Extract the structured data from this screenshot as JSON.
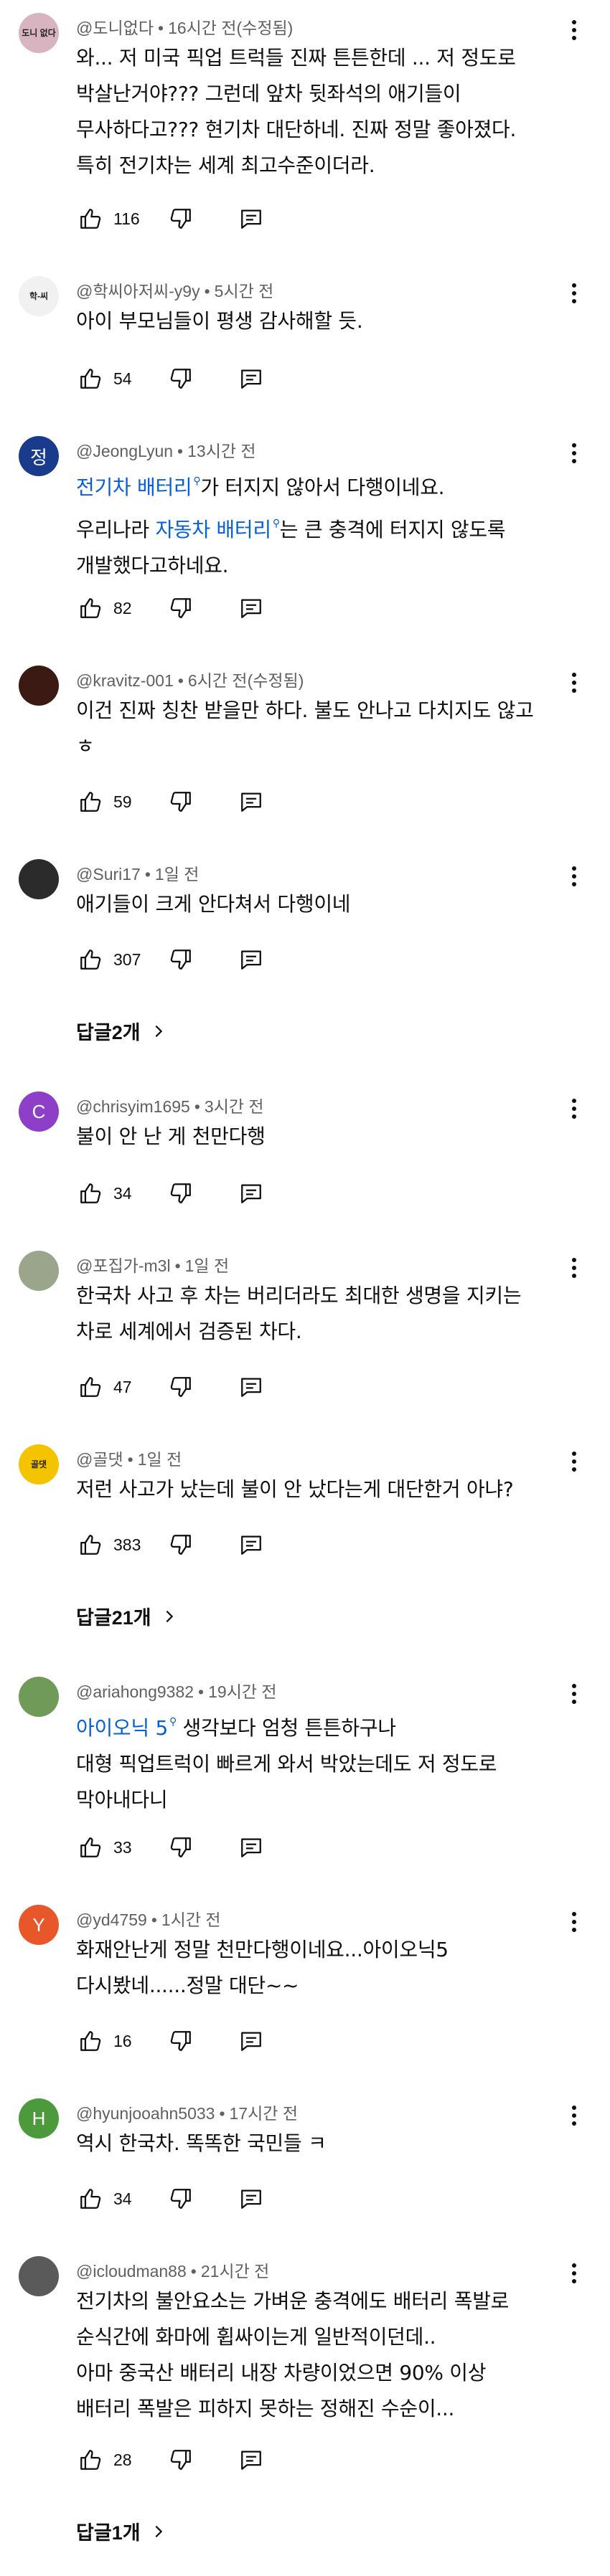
{
  "colors": {
    "link": "#065fd4",
    "meta": "#606060",
    "text": "#0f0f0f"
  },
  "replies_label": "답글",
  "comments": [
    {
      "author": "@도니없다",
      "time": "16시간 전(수정됨)",
      "avatar": {
        "type": "image",
        "text": "도니 없다",
        "bg": "#d8b4c0"
      },
      "lines": [
        [
          {
            "t": "와... 저 미국 픽업 트럭들 진짜 튼튼한데 ... 저 정도로"
          }
        ],
        [
          {
            "t": "박살난거야??? 그런데 앞차 뒷좌석의 애기들이"
          }
        ],
        [
          {
            "t": "무사하다고??? 현기차 대단하네. 진짜 정말 좋아졌다."
          }
        ],
        [
          {
            "t": "특히 전기차는 세계 최고수준이더라."
          }
        ]
      ],
      "likes": "116"
    },
    {
      "author": "@학씨아저씨-y9y",
      "time": "5시간 전",
      "avatar": {
        "type": "image",
        "text": "학-씨",
        "bg": "#f1f1f1"
      },
      "lines": [
        [
          {
            "t": "아이 부모님들이 평생 감사해할 듯."
          }
        ]
      ],
      "likes": "54"
    },
    {
      "author": "@JeongLyun",
      "time": "13시간 전",
      "avatar": {
        "type": "letter",
        "text": "정",
        "bg": "#1a3b8c"
      },
      "lines": [
        [
          {
            "t": "전기차 배터리",
            "link": true
          },
          {
            "t": "가 터지지 않아서 다행이네요."
          }
        ],
        [
          {
            "t": "우리나라 "
          },
          {
            "t": "자동차 배터리",
            "link": true
          },
          {
            "t": "는 큰 충격에 터지지 않도록"
          }
        ],
        [
          {
            "t": "개발했다고하네요."
          }
        ]
      ],
      "likes": "82"
    },
    {
      "author": "@kravitz-001",
      "time": "6시간 전(수정됨)",
      "avatar": {
        "type": "image",
        "text": "",
        "bg": "#3a1a12"
      },
      "lines": [
        [
          {
            "t": "이건 진짜 칭찬 받을만 하다. 불도 안나고 다치지도 않고"
          }
        ],
        [
          {
            "t": "ㅎ"
          }
        ]
      ],
      "likes": "59"
    },
    {
      "author": "@Suri17",
      "time": "1일 전",
      "avatar": {
        "type": "image",
        "text": "",
        "bg": "#2b2b2b"
      },
      "lines": [
        [
          {
            "t": "애기들이 크게 안다쳐서 다행이네"
          }
        ]
      ],
      "likes": "307",
      "replies": "2개"
    },
    {
      "author": "@chrisyim1695",
      "time": "3시간 전",
      "avatar": {
        "type": "letter",
        "text": "C",
        "bg": "#8e3fc7"
      },
      "lines": [
        [
          {
            "t": "불이 안 난 게 천만다행"
          }
        ]
      ],
      "likes": "34"
    },
    {
      "author": "@포집가-m3l",
      "time": "1일 전",
      "avatar": {
        "type": "image",
        "text": "",
        "bg": "#9aa58c"
      },
      "lines": [
        [
          {
            "t": "한국차 사고 후 차는 버리더라도 최대한 생명을 지키는"
          }
        ],
        [
          {
            "t": "차로 세계에서 검증된 차다."
          }
        ]
      ],
      "likes": "47"
    },
    {
      "author": "@골댓",
      "time": "1일 전",
      "avatar": {
        "type": "image",
        "text": "골댓",
        "bg": "#f5c400"
      },
      "lines": [
        [
          {
            "t": "저런 사고가 났는데 불이 안 났다는게 대단한거 아냐?"
          }
        ]
      ],
      "likes": "383",
      "replies": "21개"
    },
    {
      "author": "@ariahong9382",
      "time": "19시간 전",
      "avatar": {
        "type": "image",
        "text": "",
        "bg": "#6f9a58"
      },
      "lines": [
        [
          {
            "t": "아이오닉 5",
            "link": true
          },
          {
            "t": " 생각보다 엄청 튼튼하구나"
          }
        ],
        [
          {
            "t": "대형 픽업트럭이 빠르게 와서 박았는데도 저 정도로"
          }
        ],
        [
          {
            "t": "막아내다니"
          }
        ]
      ],
      "likes": "33"
    },
    {
      "author": "@yd4759",
      "time": "1시간 전",
      "avatar": {
        "type": "letter",
        "text": "Y",
        "bg": "#e8572a"
      },
      "lines": [
        [
          {
            "t": "화재안난게 정말 천만다행이네요...아이오닉5"
          }
        ],
        [
          {
            "t": "다시봤네......정말 대단~~"
          }
        ]
      ],
      "likes": "16"
    },
    {
      "author": "@hyunjooahn5033",
      "time": "17시간 전",
      "avatar": {
        "type": "letter",
        "text": "H",
        "bg": "#4c9a3c"
      },
      "lines": [
        [
          {
            "t": "역시 한국차. 똑똑한 국민들 ㅋ"
          }
        ]
      ],
      "likes": "34"
    },
    {
      "author": "@icloudman88",
      "time": "21시간 전",
      "avatar": {
        "type": "image",
        "text": "",
        "bg": "#5a5a5a"
      },
      "lines": [
        [
          {
            "t": "전기차의 불안요소는 가벼운 충격에도 배터리 폭발로"
          }
        ],
        [
          {
            "t": "순식간에 화마에 휩싸이는게 일반적이던데.."
          }
        ],
        [
          {
            "t": "아마 중국산 배터리 내장 차량이었으면 90% 이상"
          }
        ],
        [
          {
            "t": "배터리 폭발은 피하지 못하는 정해진 수순이..."
          }
        ]
      ],
      "likes": "28",
      "replies": "1개"
    }
  ]
}
